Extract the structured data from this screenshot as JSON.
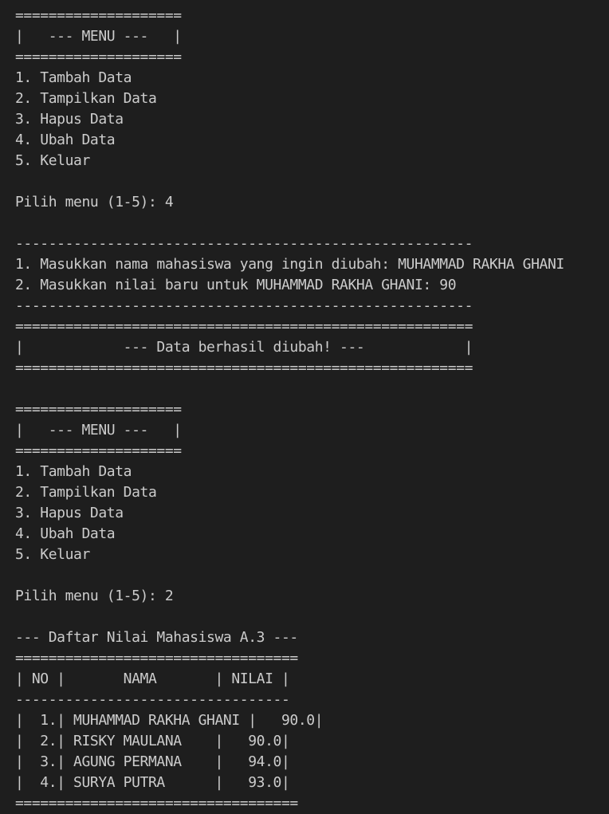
{
  "terminal": {
    "lines": [
      "====================",
      "|   --- MENU ---   |",
      "====================",
      "1. Tambah Data",
      "2. Tampilkan Data",
      "3. Hapus Data",
      "4. Ubah Data",
      "5. Keluar",
      "",
      "Pilih menu (1-5): 4",
      "",
      "-------------------------------------------------------",
      "1. Masukkan nama mahasiswa yang ingin diubah: MUHAMMAD RAKHA GHANI",
      "2. Masukkan nilai baru untuk MUHAMMAD RAKHA GHANI: 90",
      "-------------------------------------------------------",
      "=======================================================",
      "|            --- Data berhasil diubah! ---            |",
      "=======================================================",
      "",
      "====================",
      "|   --- MENU ---   |",
      "====================",
      "1. Tambah Data",
      "2. Tampilkan Data",
      "3. Hapus Data",
      "4. Ubah Data",
      "5. Keluar",
      "",
      "Pilih menu (1-5): 2",
      "",
      "--- Daftar Nilai Mahasiswa A.3 ---",
      "==================================",
      "| NO |       NAMA       | NILAI |",
      "---------------------------------",
      "|  1.| MUHAMMAD RAKHA GHANI |   90.0|",
      "|  2.| RISKY MAULANA    |   90.0|",
      "|  3.| AGUNG PERMANA    |   94.0|",
      "|  4.| SURYA PUTRA      |   93.0|",
      "=================================="
    ]
  }
}
